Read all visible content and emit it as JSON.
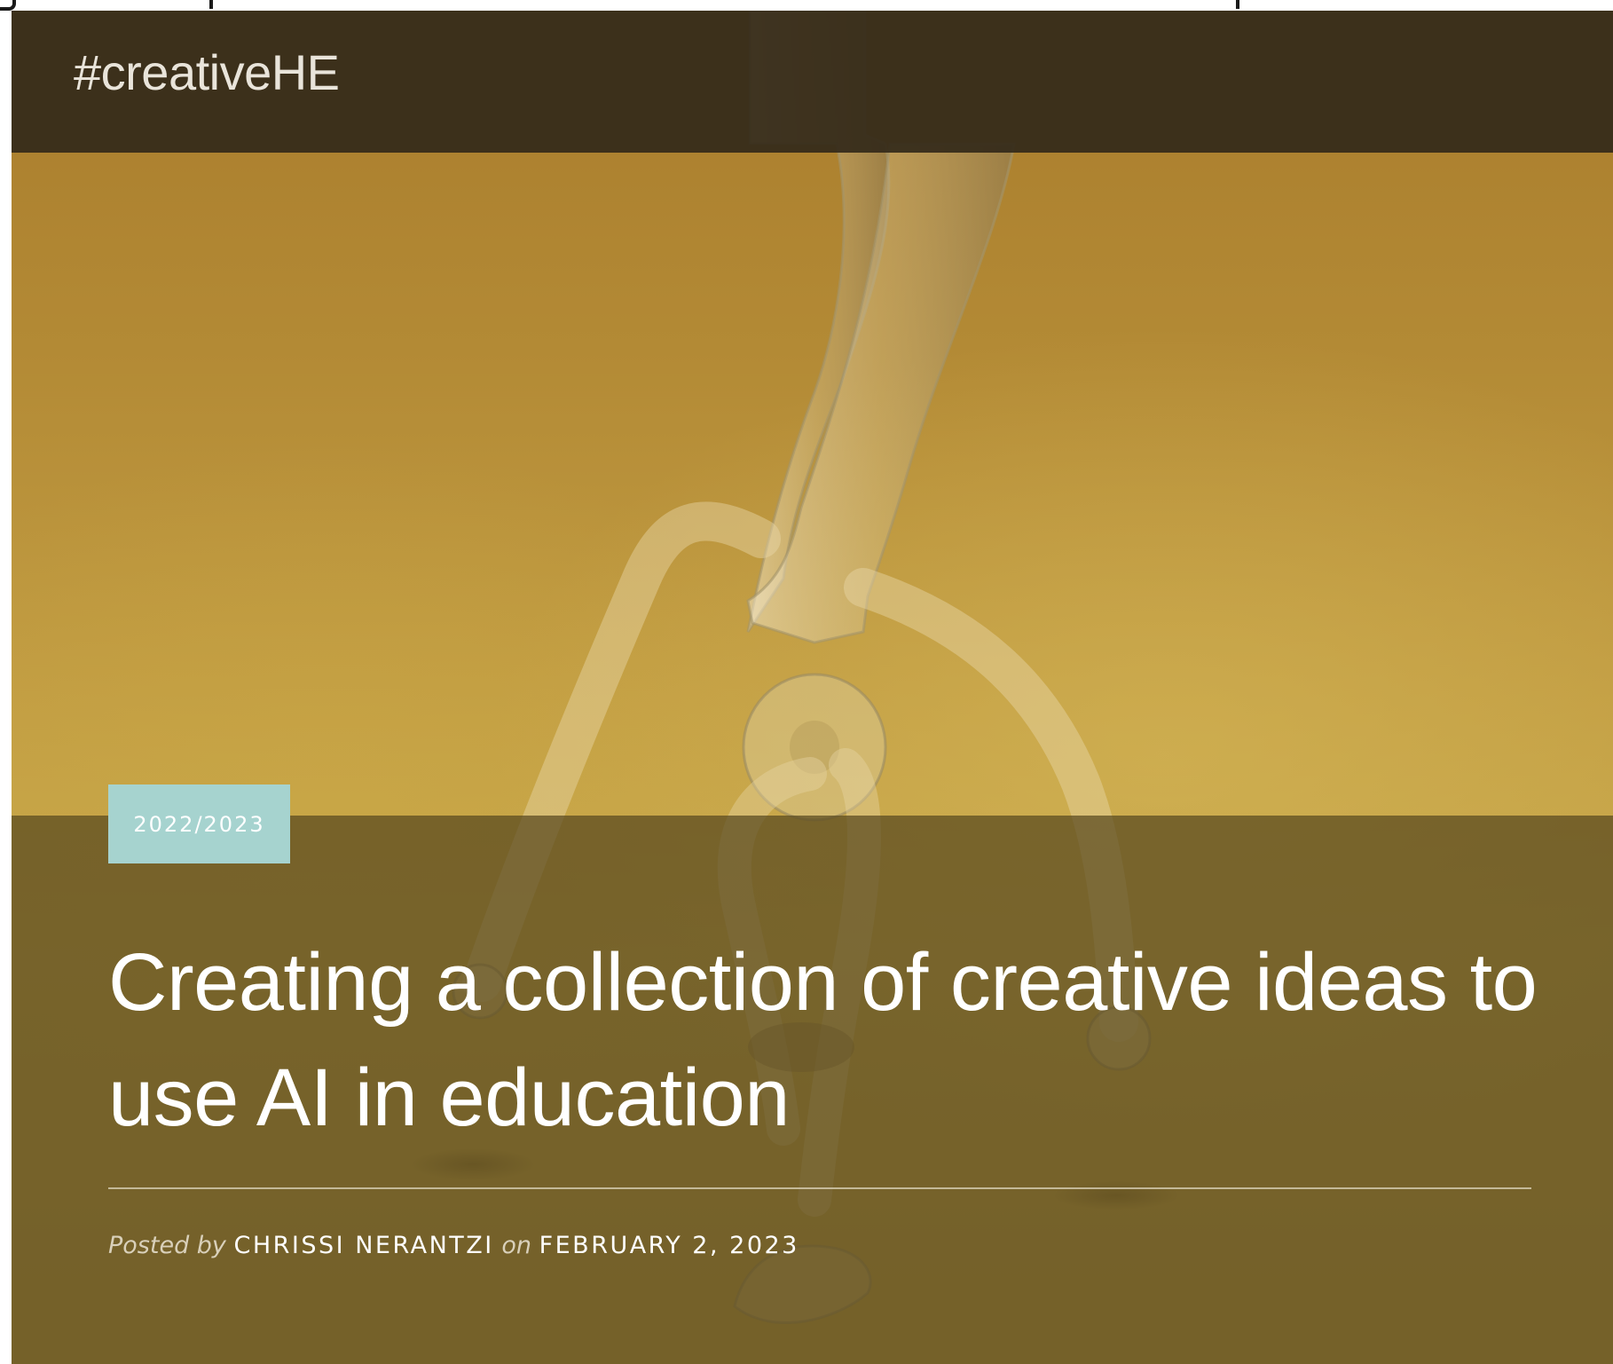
{
  "site": {
    "title": "#creativeHE"
  },
  "post": {
    "category": "2022/2023",
    "title": "Creating a collection of creative ideas to use AI in education",
    "posted_by_label": "Posted by",
    "author": "CHRISSI NERANTZI",
    "on_label": "on",
    "date": "FEBRUARY 2, 2023"
  },
  "colors": {
    "header_bg": "#342a1a",
    "hero_yellow": "#c19c42",
    "badge_bg": "#a6d3cf",
    "overlay": "#58481e",
    "text_light": "#ffffff"
  },
  "icons": {
    "hero_image": "glass-figure-sculpture"
  }
}
